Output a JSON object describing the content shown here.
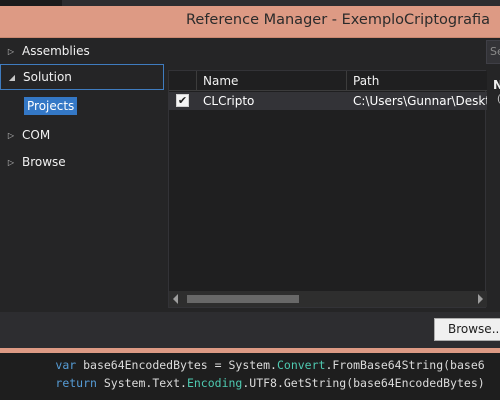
{
  "window": {
    "title": "Reference Manager - ExemploCriptografia"
  },
  "nav": {
    "items": [
      {
        "label": "Assemblies",
        "expanded": false
      },
      {
        "label": "Solution",
        "expanded": true,
        "selected": true
      },
      {
        "label": "COM",
        "expanded": false
      },
      {
        "label": "Browse",
        "expanded": false
      }
    ],
    "solution_sub": "Projects"
  },
  "list": {
    "columns": [
      "Name",
      "Path"
    ],
    "rows": [
      {
        "checked": true,
        "check_glyph": "✔",
        "name": "CLCripto",
        "path": "C:\\Users\\Gunnar\\Desktop"
      }
    ]
  },
  "right_panel": {
    "search_placeholder": "Se",
    "label": "N",
    "sub": "("
  },
  "footer": {
    "browse_label": "Browse..."
  },
  "editor": {
    "line1": {
      "indent": "        ",
      "kw": "var",
      "text1": " base64EncodedBytes = System.",
      "type": "Convert",
      "text2": ".FromBase64String(base6"
    },
    "line2": {
      "indent": "        ",
      "kw": "return",
      "text1": " System.Text.",
      "type": "Encoding",
      "text2": ".UTF8.GetString(base64EncodedBytes)"
    }
  },
  "colors": {
    "accent": "#dd9a84",
    "selection": "#3478c6",
    "keyword": "#569cd6",
    "type": "#4ec9b0"
  }
}
